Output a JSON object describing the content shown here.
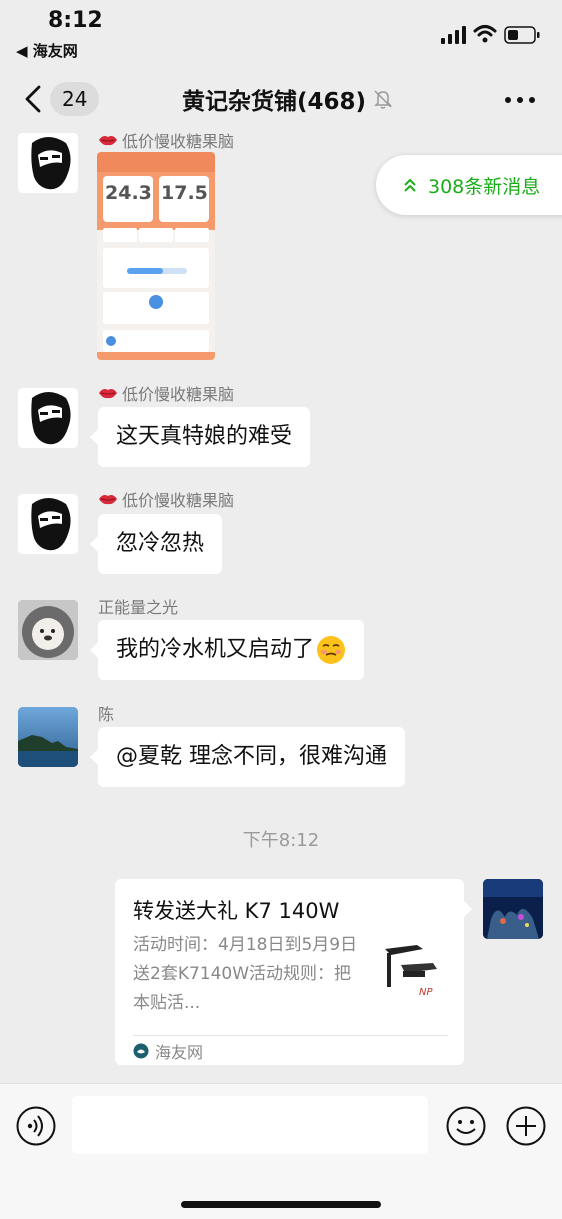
{
  "status_bar": {
    "time": "8:12",
    "back_app": "◀ 海友网"
  },
  "nav": {
    "unread_count": "24",
    "title": "黄记杂货铺(468)"
  },
  "new_messages_label": "308条新消息",
  "messages": [
    {
      "sender": "低价慢收糖果脑",
      "type": "image"
    },
    {
      "sender": "低价慢收糖果脑",
      "text": "这天真特娘的难受"
    },
    {
      "sender": "低价慢收糖果脑",
      "text": "忽冷忽热"
    },
    {
      "sender": "正能量之光",
      "text": "我的冷水机又启动了"
    },
    {
      "sender": "陈",
      "text": "@夏乾 理念不同，很难沟通"
    }
  ],
  "timestamp": "下午8:12",
  "share_card": {
    "title": "转发送大礼 K7 140W",
    "description": "活动时间：4月18日到5月9日送2套K7140W活动规则：把本贴活...",
    "source": "海友网"
  },
  "screenshot": {
    "value_left": "24.3",
    "value_right": "17.5"
  },
  "input": {
    "value": "",
    "placeholder": ""
  },
  "colors": {
    "accent_green": "#1aad19",
    "bubble": "#ffffff",
    "background": "#ededed"
  }
}
